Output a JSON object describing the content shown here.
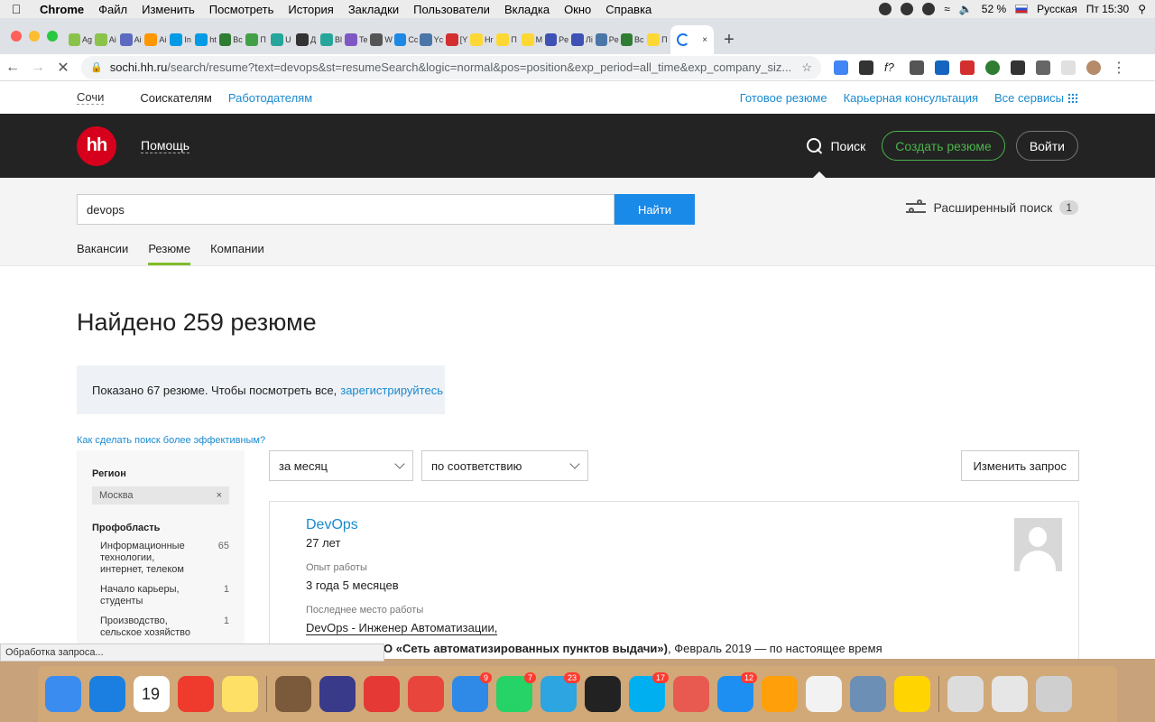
{
  "menubar": {
    "app": "Chrome",
    "items": [
      "Файл",
      "Изменить",
      "Посмотреть",
      "История",
      "Закладки",
      "Пользователи",
      "Вкладка",
      "Окно",
      "Справка"
    ],
    "battery": "52 %",
    "input_lang": "Русская",
    "clock": "Пт 15:30"
  },
  "tabs": [
    {
      "label": "Ag",
      "color": "#8bc34a"
    },
    {
      "label": "Ai",
      "color": "#8bc34a"
    },
    {
      "label": "Ai",
      "color": "#5c6bc0"
    },
    {
      "label": "Ai",
      "color": "#ff9800"
    },
    {
      "label": "In",
      "color": "#039be5"
    },
    {
      "label": "ht",
      "color": "#039be5"
    },
    {
      "label": "Bc",
      "color": "#2e7d32"
    },
    {
      "label": "П",
      "color": "#43a047"
    },
    {
      "label": "U",
      "color": "#26a69a"
    },
    {
      "label": "Д",
      "color": "#333333"
    },
    {
      "label": "Bl",
      "color": "#26a69a"
    },
    {
      "label": "Te",
      "color": "#7e57c2"
    },
    {
      "label": "W",
      "color": "#555555"
    },
    {
      "label": "Cc",
      "color": "#1e88e5"
    },
    {
      "label": "Yc",
      "color": "#4a76a8"
    },
    {
      "label": "[Y",
      "color": "#d32f2f"
    },
    {
      "label": "Hr",
      "color": "#fdd835"
    },
    {
      "label": "П",
      "color": "#fdd835"
    },
    {
      "label": "M",
      "color": "#fdd835"
    },
    {
      "label": "Pe",
      "color": "#3f51b5"
    },
    {
      "label": "Лі",
      "color": "#3f51b5"
    },
    {
      "label": "Pe",
      "color": "#4a76a8"
    },
    {
      "label": "Bc",
      "color": "#2e7d32"
    },
    {
      "label": "П",
      "color": "#fdd835"
    }
  ],
  "active_tab_close": "×",
  "new_tab": "+",
  "omnibox": {
    "host": "sochi.hh.ru",
    "path": "/search/resume?text=devops&st=resumeSearch&logic=normal&pos=position&exp_period=all_time&exp_company_siz..."
  },
  "topnav": {
    "city": "Сочи",
    "seekers": "Соискателям",
    "employers": "Работодателям",
    "ready_resume": "Готовое резюме",
    "career": "Карьерная консультация",
    "all_services": "Все сервисы"
  },
  "header": {
    "logo": "hh",
    "help": "Помощь",
    "search": "Поиск",
    "create_resume": "Создать резюме",
    "login": "Войти"
  },
  "search": {
    "query": "devops",
    "find_button": "Найти",
    "advanced": "Расширенный поиск",
    "advanced_count": "1",
    "tabs": [
      "Вакансии",
      "Резюме",
      "Компании"
    ]
  },
  "results": {
    "found_title": "Найдено 259 резюме",
    "notice_text": "Показано 67 резюме. Чтобы посмотреть все,",
    "notice_link": "зарегистрируйтесь",
    "tip": "Как сделать поиск более эффективным?"
  },
  "sidebar": {
    "region_title": "Регион",
    "region_value": "Москва",
    "region_clear": "×",
    "prof_title": "Профобласть",
    "prof_items": [
      {
        "label": "Информационные технологии, интернет, телеком",
        "count": "65"
      },
      {
        "label": "Начало карьеры, студенты",
        "count": "1"
      },
      {
        "label": "Производство, сельское хозяйство",
        "count": "1"
      }
    ]
  },
  "filters": {
    "period": "за месяц",
    "sort": "по соответствию",
    "change_query": "Изменить запрос"
  },
  "card": {
    "title": "DevOps",
    "age": "27 лет",
    "exp_label": "Опыт работы",
    "exp_value": "3 года 5 месяцев",
    "last_label": "Последнее место работы",
    "last_position": "DevOps - Инженер Автоматизации,",
    "company_name": "О «Сеть автоматизированных пунктов выдачи»)",
    "company_period": ", Февраль 2019 — по настоящее время"
  },
  "status": "Обработка запроса...",
  "dock": [
    {
      "name": "finder",
      "color": "#3b8cf0"
    },
    {
      "name": "safari",
      "color": "#1a7fe0"
    },
    {
      "name": "calendar",
      "color": "#ffffff",
      "text": "19"
    },
    {
      "name": "anydesk",
      "color": "#ef3b2d"
    },
    {
      "name": "notes",
      "color": "#ffe066"
    },
    {
      "name": "sep"
    },
    {
      "name": "gimp",
      "color": "#7a5a3a"
    },
    {
      "name": "xmind",
      "color": "#3a3a8a"
    },
    {
      "name": "xmind-x",
      "color": "#e53935"
    },
    {
      "name": "chrome",
      "color": "#e8453c"
    },
    {
      "name": "24",
      "color": "#2f89e6",
      "badge": "9"
    },
    {
      "name": "whatsapp",
      "color": "#25d366",
      "badge": "7"
    },
    {
      "name": "telegram",
      "color": "#2ca5e0",
      "badge": "23"
    },
    {
      "name": "terminal",
      "color": "#222222"
    },
    {
      "name": "skype",
      "color": "#00aff0",
      "badge": "17"
    },
    {
      "name": "screen-share",
      "color": "#e85a4f"
    },
    {
      "name": "app-store",
      "color": "#1d8ff3",
      "badge": "12"
    },
    {
      "name": "calculator",
      "color": "#ff9f0a"
    },
    {
      "name": "textedit",
      "color": "#f2f2f2"
    },
    {
      "name": "preview",
      "color": "#6c8fb5"
    },
    {
      "name": "vpn",
      "color": "#ffd400"
    },
    {
      "name": "sep"
    },
    {
      "name": "quicktime",
      "color": "#dcdcdc"
    },
    {
      "name": "downloads",
      "color": "#e6e6e6"
    },
    {
      "name": "trash",
      "color": "#cfcfcf"
    }
  ]
}
